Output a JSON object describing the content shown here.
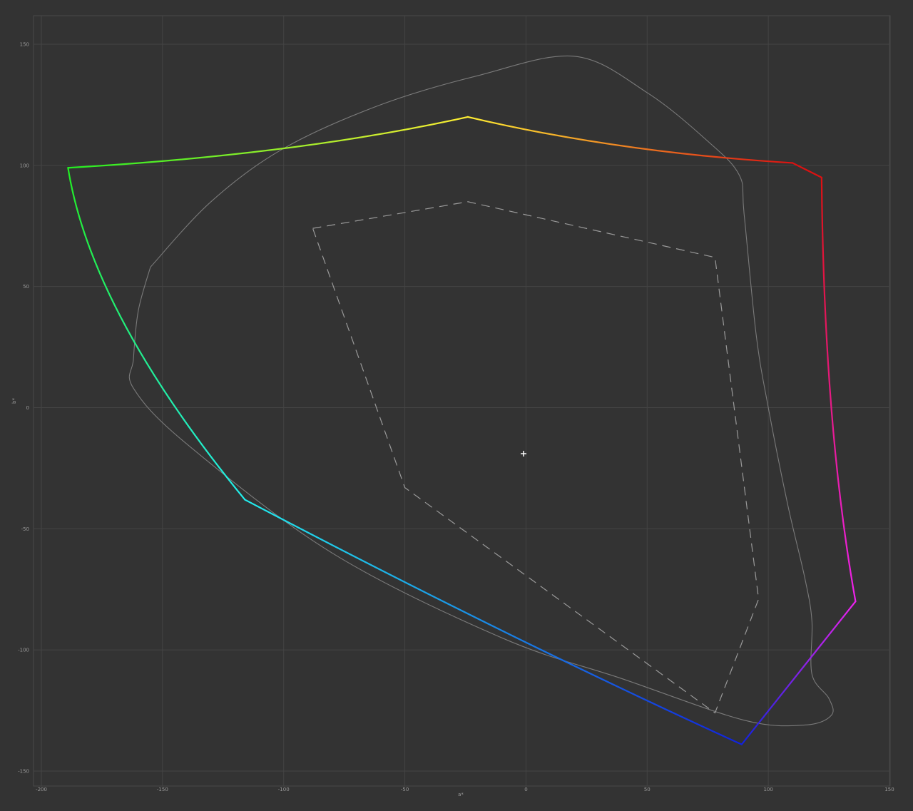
{
  "chart_data": {
    "type": "line",
    "xlabel": "a*",
    "ylabel": "b*",
    "xlim": [
      -200,
      150
    ],
    "ylim": [
      -150,
      150
    ],
    "xticks": [
      -200,
      -150,
      -100,
      -50,
      0,
      50,
      100,
      150
    ],
    "yticks": [
      150,
      100,
      50,
      0,
      -50,
      -100,
      -150
    ],
    "grid": true,
    "background": "#333333",
    "grid_color": "#444444",
    "white_point": {
      "x": -1,
      "y": -19
    },
    "gamut_boundary": {
      "style": "solid-gradient",
      "vertices": [
        {
          "x": -189,
          "y": 99,
          "color": "#22ee22"
        },
        {
          "x": -24,
          "y": 120,
          "color": "#ffee33"
        },
        {
          "x": 110,
          "y": 101,
          "color": "#dd1111"
        },
        {
          "x": 122,
          "y": 95,
          "color": "#dd1111"
        },
        {
          "x": 136,
          "y": -80,
          "color": "#ee22ee"
        },
        {
          "x": 89,
          "y": -139,
          "color": "#1122dd"
        },
        {
          "x": -116,
          "y": -38,
          "color": "#22eeee"
        }
      ],
      "edges": [
        {
          "from": 0,
          "to": 1,
          "bulge": [
            -100,
            107
          ]
        },
        {
          "from": 1,
          "to": 2,
          "bulge": [
            40,
            108
          ]
        },
        {
          "from": 2,
          "to": 3
        },
        {
          "from": 3,
          "to": 4,
          "bulge": [
            126,
            0
          ]
        },
        {
          "from": 4,
          "to": 5
        },
        {
          "from": 5,
          "to": 6,
          "bulge": [
            -10,
            -92
          ]
        },
        {
          "from": 6,
          "to": 0,
          "bulge": [
            -166,
            35
          ]
        }
      ]
    },
    "reference_gamut_dashed": [
      [
        -88,
        74
      ],
      [
        -24,
        85
      ],
      [
        78,
        62
      ],
      [
        96,
        -79
      ],
      [
        78,
        -126
      ],
      [
        -50,
        -33
      ],
      [
        -88,
        74
      ]
    ],
    "reference_outline_solid": [
      [
        -155,
        58
      ],
      [
        -130,
        85
      ],
      [
        -100,
        107
      ],
      [
        -60,
        125
      ],
      [
        -20,
        137
      ],
      [
        20,
        145
      ],
      [
        50,
        130
      ],
      [
        75,
        110
      ],
      [
        88,
        96
      ],
      [
        90,
        80
      ],
      [
        95,
        30
      ],
      [
        100,
        0
      ],
      [
        108,
        -40
      ],
      [
        115,
        -70
      ],
      [
        118,
        -88
      ],
      [
        118,
        -110
      ],
      [
        125,
        -120
      ],
      [
        126,
        -127
      ],
      [
        115,
        -131
      ],
      [
        90,
        -129
      ],
      [
        40,
        -112
      ],
      [
        -10,
        -95
      ],
      [
        -80,
        -60
      ],
      [
        -140,
        -15
      ],
      [
        -162,
        8
      ],
      [
        -162,
        20
      ],
      [
        -160,
        40
      ],
      [
        -155,
        58
      ]
    ]
  }
}
